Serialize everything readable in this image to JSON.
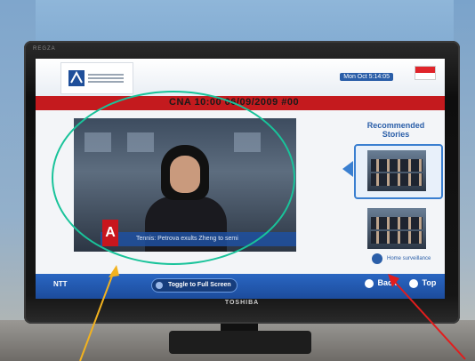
{
  "tv": {
    "brand": "TOSHIBA",
    "brand_top": "REGZA"
  },
  "header": {
    "clock": "Mon Oct 5:14:05",
    "channel_info": "CNA 10:00 06/09/2009 #00"
  },
  "video": {
    "ticker_text": "Tennis: Petrova exults Zheng to semi",
    "channel_logo": "A"
  },
  "recommended": {
    "title": "Recommended Stories",
    "item_label": "Home surveillance"
  },
  "footer": {
    "brand": "NTT",
    "toggle_label": "Toggle to Full Screen",
    "back_label": "Back",
    "top_label": "Top"
  },
  "colors": {
    "ellipse": "#19c39a",
    "arrow_left": "#f2b21f",
    "arrow_right": "#e21d1d",
    "accent": "#2a5ea8",
    "red_bar": "#c41a1e"
  }
}
